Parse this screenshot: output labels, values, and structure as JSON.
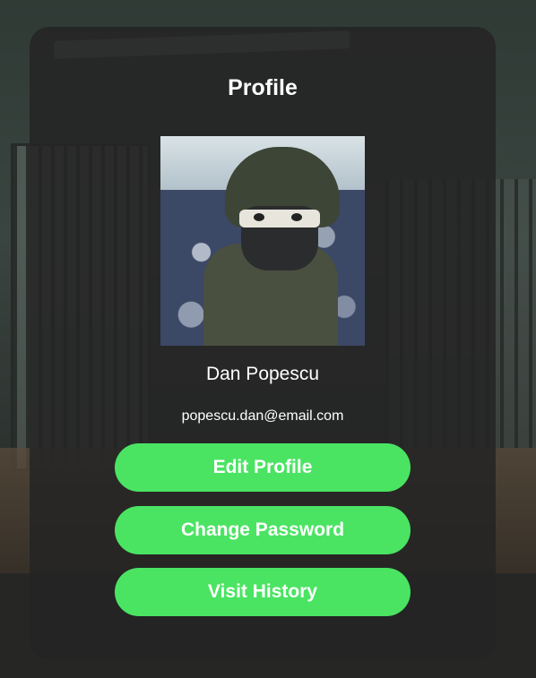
{
  "profile": {
    "title": "Profile",
    "name": "Dan Popescu",
    "email": "popescu.dan@email.com"
  },
  "actions": {
    "edit_profile": "Edit Profile",
    "change_password": "Change Password",
    "visit_history": "Visit History"
  },
  "colors": {
    "button": "#4ae462",
    "card": "#242424",
    "text": "#ffffff"
  }
}
